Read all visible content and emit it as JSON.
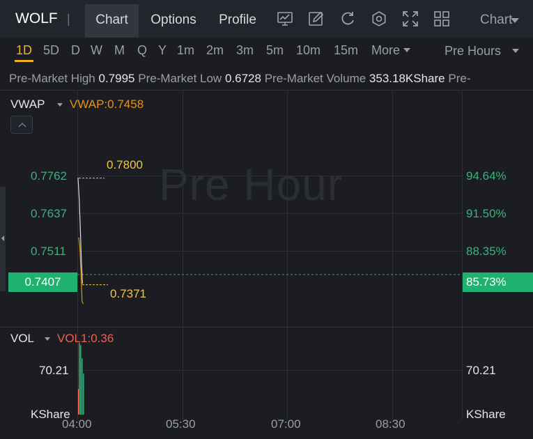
{
  "header": {
    "ticker": "WOLF",
    "separator": "|",
    "tabs": [
      {
        "label": "Chart",
        "active": true
      },
      {
        "label": "Options",
        "active": false
      },
      {
        "label": "Profile",
        "active": false
      }
    ],
    "tools": [
      "chart-settings-icon",
      "draw-icon",
      "refresh-icon",
      "settings-icon",
      "fullscreen-icon",
      "layout-icon"
    ],
    "chart_type_label": "Chart"
  },
  "periods": {
    "items": [
      "1D",
      "5D",
      "D",
      "W",
      "M",
      "Q",
      "Y",
      "1m",
      "2m",
      "3m",
      "5m",
      "10m",
      "15m",
      "More"
    ],
    "active": "1D",
    "session": "Pre Hours"
  },
  "premarket": {
    "high_label": "Pre-Market High",
    "high_value": "0.7995",
    "low_label": "Pre-Market Low",
    "low_value": "0.6728",
    "volume_label": "Pre-Market Volume",
    "volume_value": "353.18KShare",
    "trailing": "Pre-"
  },
  "price_pane": {
    "indicator": "VWAP",
    "indicator_value": "VWAP:0.7458",
    "watermark": "Pre Hour",
    "y_ticks_left": [
      "0.7762",
      "0.7637",
      "0.7511"
    ],
    "y_ticks_right": [
      "94.64%",
      "91.50%",
      "88.35%"
    ],
    "current_price": "0.7407",
    "current_pct": "85.73%",
    "high_marker": "0.7800",
    "low_marker": "0.7371"
  },
  "volume_pane": {
    "indicator": "VOL",
    "indicator_value": "VOL1:0.36",
    "tick_left": "70.21",
    "tick_right": "70.21",
    "unit_left": "KShare",
    "unit_right": "KShare"
  },
  "x_axis": {
    "ticks": [
      "04:00",
      "05:30",
      "07:00",
      "08:30"
    ]
  },
  "colors": {
    "background": "#1b1d22",
    "accent": "#f2b01e",
    "up": "#1fb170",
    "vwap": "#e6931d",
    "marker": "#f2c744",
    "volume_down": "#f0614f"
  },
  "chart_data": {
    "type": "line",
    "title": "",
    "xlabel": "",
    "ylabel": "",
    "x": [
      "04:00",
      "04:01",
      "04:02",
      "04:03",
      "04:04"
    ],
    "series": [
      {
        "values": [
          0.78,
          0.772,
          0.76,
          0.746,
          0.7371
        ]
      },
      {
        "name": "VWAP",
        "values": [
          0.77,
          0.766,
          0.756,
          0.744,
          0.743
        ]
      }
    ],
    "current": 0.7407,
    "ylim": [
      0.7333,
      0.783
    ],
    "volume": {
      "name": "VOL",
      "values": [
        70.21,
        68.0,
        55.0,
        40.0
      ],
      "down_values": [
        25.0
      ]
    },
    "grid": true
  }
}
